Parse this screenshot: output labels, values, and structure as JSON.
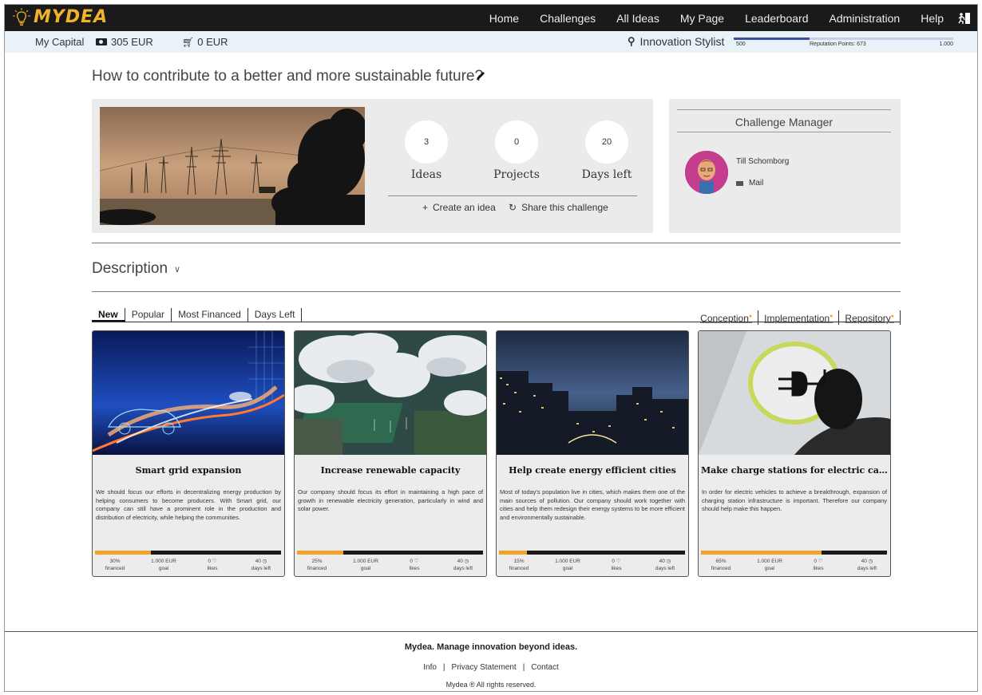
{
  "app": {
    "brand": "MYDEA"
  },
  "nav": {
    "items": [
      "Home",
      "Challenges",
      "All Ideas",
      "My Page",
      "Leaderboard",
      "Administration",
      "Help"
    ]
  },
  "capital": {
    "label": "My Capital",
    "money": "305 EUR",
    "cart": "0 EUR"
  },
  "reputation": {
    "rank": "Innovation Stylist",
    "min": "500",
    "points_label": "Reputation Points: 673",
    "max": "1.000",
    "points": 673,
    "min_value": 500,
    "max_value": 1000
  },
  "challenge": {
    "title": "How to contribute to a better and more sustainable future?",
    "stats": [
      {
        "value": "3",
        "label": "Ideas"
      },
      {
        "value": "0",
        "label": "Projects"
      },
      {
        "value": "20",
        "label": "Days left"
      }
    ],
    "create_label": "Create an idea",
    "share_label": "Share this challenge"
  },
  "manager": {
    "heading": "Challenge Manager",
    "name": "Till Schomborg",
    "mail": "Mail"
  },
  "description": {
    "label": "Description"
  },
  "tabs": [
    "New",
    "Popular",
    "Most Financed",
    "Days Left"
  ],
  "phases": [
    "Conception",
    "Implementation",
    "Repository"
  ],
  "ideas": [
    {
      "title": "Smart grid expansion",
      "desc": "We should focus our efforts in decentralizing energy production by helping consumers to become producers. With Smart grid, our company can still have a prominent role in the production and distribution of electricity, while helping the communities.",
      "financed": "30%",
      "financed_value": 0.3,
      "goal": "1.000 EUR",
      "likes": "0 ♡",
      "days": "40 ◷",
      "financed_label": "financed",
      "goal_label": "goal",
      "likes_label": "likes",
      "days_label": "days left"
    },
    {
      "title": "Increase renewable capacity",
      "desc": "Our company should focus its effort in maintaining a high pace of growth in renewable electricity generation, particularly in wind and solar power.",
      "financed": "25%",
      "financed_value": 0.25,
      "goal": "1.000 EUR",
      "likes": "0 ♡",
      "days": "40 ◷",
      "financed_label": "financed",
      "goal_label": "goal",
      "likes_label": "likes",
      "days_label": "days left"
    },
    {
      "title": "Help create energy efficient cities",
      "desc": "Most of today's population live in cities, which makes them one of the main sources of pollution. Our company should work together with cities and help them redesign their energy systems to be more efficient and environmentally sustainable.",
      "financed": "15%",
      "financed_value": 0.15,
      "goal": "1.000 EUR",
      "likes": "0 ♡",
      "days": "40 ◷",
      "financed_label": "financed",
      "goal_label": "goal",
      "likes_label": "likes",
      "days_label": "days left"
    },
    {
      "title": "Make charge stations for electric cars widely a...",
      "desc": "In order for electric vehicles to achieve a breakthrough, expansion of charging station infrastructure is important. Therefore our company should help make this happen.",
      "financed": "65%",
      "financed_value": 0.65,
      "goal": "1.000 EUR",
      "likes": "0 ♡",
      "days": "40 ◷",
      "financed_label": "financed",
      "goal_label": "goal",
      "likes_label": "likes",
      "days_label": "days left"
    }
  ],
  "footer": {
    "tagline": "Mydea. Manage innovation beyond ideas.",
    "links": [
      "Info",
      "Privacy Statement",
      "Contact"
    ],
    "copyright": "Mydea ® All rights reserved."
  }
}
